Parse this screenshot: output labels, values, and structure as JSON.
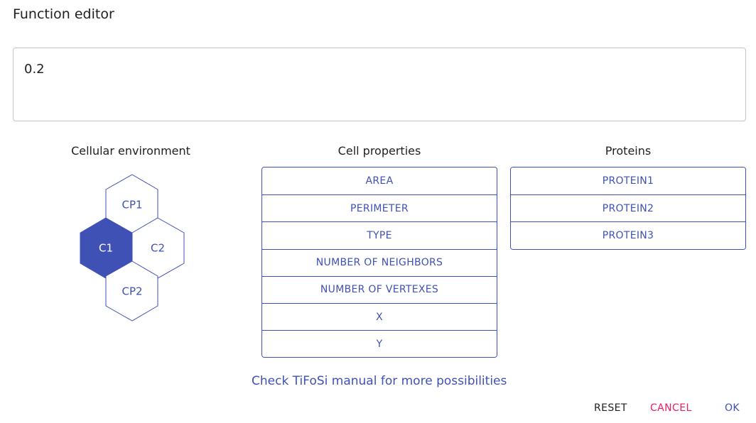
{
  "dialog": {
    "title": "Function editor",
    "function_value": "0.2"
  },
  "environment": {
    "title": "Cellular environment",
    "cells": [
      {
        "label": "CP1",
        "selected": false
      },
      {
        "label": "C1",
        "selected": true
      },
      {
        "label": "C2",
        "selected": false
      },
      {
        "label": "CP2",
        "selected": false
      }
    ]
  },
  "cell_properties": {
    "title": "Cell properties",
    "items": [
      "AREA",
      "PERIMETER",
      "TYPE",
      "NUMBER OF NEIGHBORS",
      "NUMBER OF VERTEXES",
      "X",
      "Y"
    ]
  },
  "proteins": {
    "title": "Proteins",
    "items": [
      "PROTEIN1",
      "PROTEIN2",
      "PROTEIN3"
    ]
  },
  "manual_link": "Check TiFoSi manual for more possibilities",
  "actions": {
    "reset": "RESET",
    "cancel": "CANCEL",
    "ok": "OK"
  },
  "colors": {
    "primary": "#3f51b5",
    "secondary": "#e91e63",
    "text": "#212121"
  }
}
